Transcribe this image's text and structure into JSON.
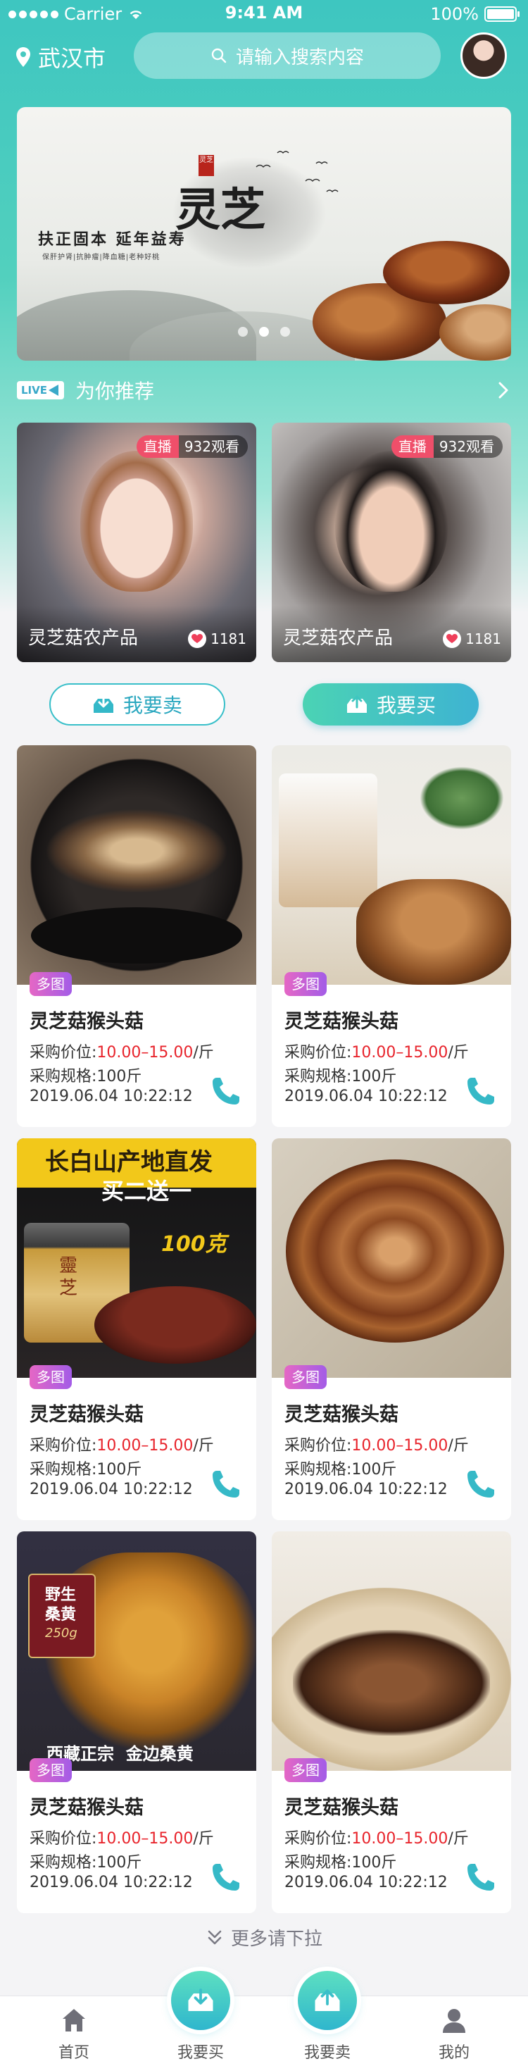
{
  "status_bar": {
    "carrier": "Carrier",
    "time": "9:41 AM",
    "battery": "100%"
  },
  "header": {
    "city": "武汉市",
    "search_placeholder": "请输入搜索内容"
  },
  "banner": {
    "title": "灵芝",
    "seal": "灵芝",
    "slogan": "扶正固本  延年益寿",
    "small_text": "保肝护肾|抗肿瘤|降血糖|老种好桃",
    "slides": 3,
    "active_slide": 1
  },
  "recommend": {
    "live_badge": "LIVE",
    "title": "为你推荐"
  },
  "live_cards": [
    {
      "status": "直播",
      "views": "932观看",
      "name": "灵芝菇农产品",
      "likes": "1181"
    },
    {
      "status": "直播",
      "views": "932观看",
      "name": "灵芝菇农产品",
      "likes": "1181"
    }
  ],
  "actions": {
    "sell": "我要卖",
    "buy": "我要买"
  },
  "products": [
    {
      "tag": "多图",
      "title": "灵芝菇猴头菇",
      "price_label": "采购价位:",
      "price": "10.00–15.00",
      "unit": "/斤",
      "spec": "采购规格:100斤",
      "date": "2019.06.04 10:22:12",
      "image": "dried-lingzhi-bowl"
    },
    {
      "tag": "多图",
      "title": "灵芝菇猴头菇",
      "price_label": "采购价位:",
      "price": "10.00–15.00",
      "unit": "/斤",
      "spec": "采购规格:100斤",
      "date": "2019.06.04 10:22:12",
      "image": "lingzhi-tea"
    },
    {
      "tag": "多图",
      "title": "灵芝菇猴头菇",
      "price_label": "采购价位:",
      "price": "10.00–15.00",
      "unit": "/斤",
      "spec": "采购规格:100斤",
      "date": "2019.06.04 10:22:12",
      "image": "lingzhi-powder-jar",
      "promo": {
        "line1": "长白山产地直发",
        "line2": "买二送一",
        "weight": "100克",
        "jar": "靈芝"
      }
    },
    {
      "tag": "多图",
      "title": "灵芝菇猴头菇",
      "price_label": "采购价位:",
      "price": "10.00–15.00",
      "unit": "/斤",
      "spec": "采购规格:100斤",
      "date": "2019.06.04 10:22:12",
      "image": "whole-lingzhi"
    },
    {
      "tag": "多图",
      "title": "灵芝菇猴头菇",
      "price_label": "采购价位:",
      "price": "10.00–15.00",
      "unit": "/斤",
      "spec": "采购规格:100斤",
      "date": "2019.06.04 10:22:12",
      "image": "sanghuang",
      "promo": {
        "badge_line1": "野生",
        "badge_line2": "桑黄",
        "badge_weight": "250g",
        "footer": "西藏正宗  金边桑黄"
      }
    },
    {
      "tag": "多图",
      "title": "灵芝菇猴头菇",
      "price_label": "采购价位:",
      "price": "10.00–15.00",
      "unit": "/斤",
      "spec": "采购规格:100斤",
      "date": "2019.06.04 10:22:12",
      "image": "lingzhi-slices-plate"
    }
  ],
  "more": "更多请下拉",
  "tabbar": [
    {
      "label": "首页",
      "icon": "home-icon"
    },
    {
      "label": "我要买",
      "icon": "download-tray-icon"
    },
    {
      "label": "我要卖",
      "icon": "upload-tray-icon"
    },
    {
      "label": "我的",
      "icon": "user-icon"
    }
  ],
  "colors": {
    "accent": "#3ec6c0",
    "price": "#e8242c",
    "tag_gradient": [
      "#e567c5",
      "#a35ce7"
    ],
    "live": "#ef4f6a"
  }
}
